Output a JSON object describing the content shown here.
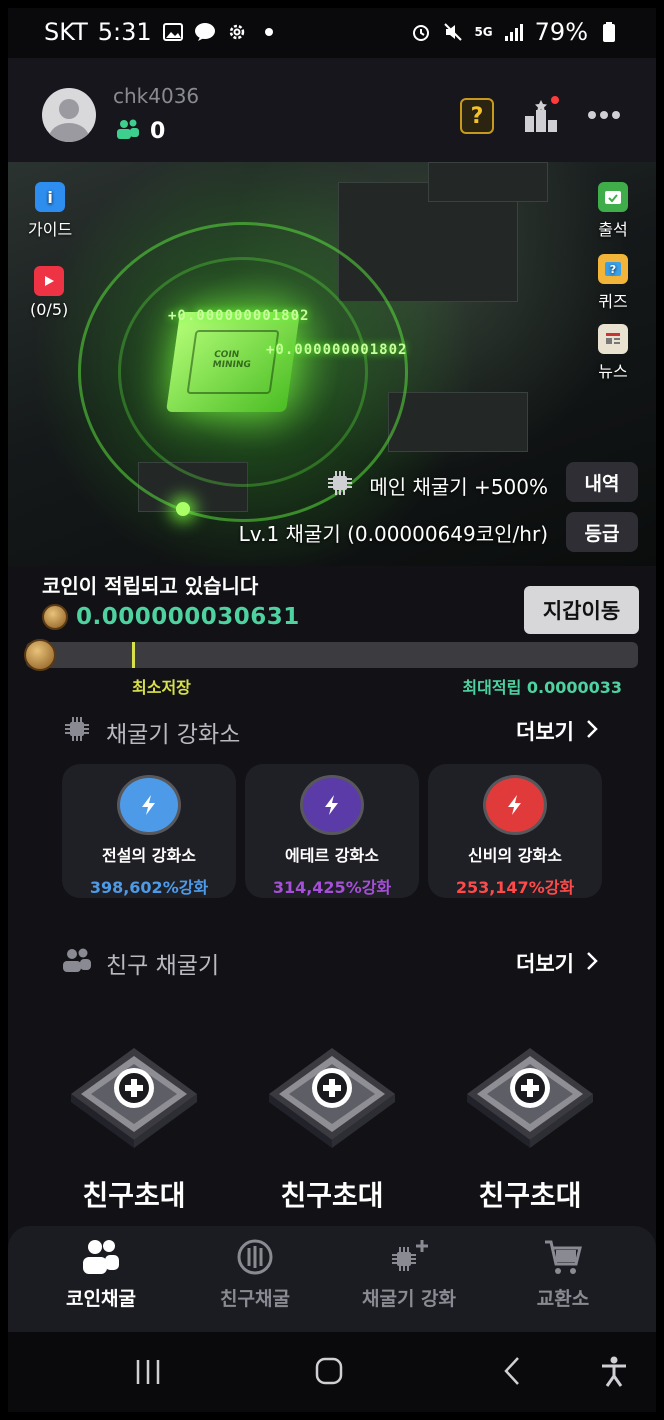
{
  "status_bar": {
    "carrier": "SKT",
    "time": "5:31",
    "network": "5G",
    "battery": "79%"
  },
  "header": {
    "username": "chk4036",
    "friend_count": "0",
    "quiz_symbol": "?"
  },
  "hero": {
    "left_items": [
      {
        "label": "가이드",
        "icon": "guide-icon"
      },
      {
        "label": "(0/5)",
        "icon": "video-ad-icon"
      }
    ],
    "right_items": [
      {
        "label": "출석",
        "icon": "attendance-icon"
      },
      {
        "label": "퀴즈",
        "icon": "quiz-icon"
      },
      {
        "label": "뉴스",
        "icon": "news-icon"
      }
    ],
    "float_text_1": "+0.000000001802",
    "float_text_2": "+0.000000001802",
    "chip_text": "COIN MINING",
    "main_miner_text": "메인 채굴기 +500%",
    "level_text": "Lv.1 채굴기  (0.00000649코인/hr)",
    "history_button": "내역",
    "grade_button": "등급"
  },
  "accumulation": {
    "title": "코인이 적립되고 있습니다",
    "value": "0.000000030631",
    "wallet_button": "지갑이동",
    "progress_fraction": 0.18,
    "min_save_label": "최소저장",
    "max_accum_label": "최대적립 0.0000033"
  },
  "upgrade_section": {
    "title": "채굴기 강화소",
    "more": "더보기",
    "cards": [
      {
        "name": "전설의 강화소",
        "percent": "398,602%강화",
        "color": "#4d9be8",
        "ring": "#3b7fd0"
      },
      {
        "name": "에테르 강화소",
        "percent": "314,425%강화",
        "color": "#a64fd8",
        "ring": "#6a3bb0"
      },
      {
        "name": "신비의 강화소",
        "percent": "253,147%강화",
        "color": "#ff4a4a",
        "ring": "#e03a3a"
      }
    ]
  },
  "friend_section": {
    "title": "친구 채굴기",
    "more": "더보기",
    "slots": [
      {
        "label": "친구초대"
      },
      {
        "label": "친구초대"
      },
      {
        "label": "친구초대"
      }
    ]
  },
  "bottom_nav": [
    {
      "label": "코인채굴",
      "icon": "people-icon",
      "active": true
    },
    {
      "label": "친구채굴",
      "icon": "coin-chip-icon",
      "active": false
    },
    {
      "label": "채굴기 강화",
      "icon": "miner-plus-icon",
      "active": false
    },
    {
      "label": "교환소",
      "icon": "cart-icon",
      "active": false
    }
  ]
}
